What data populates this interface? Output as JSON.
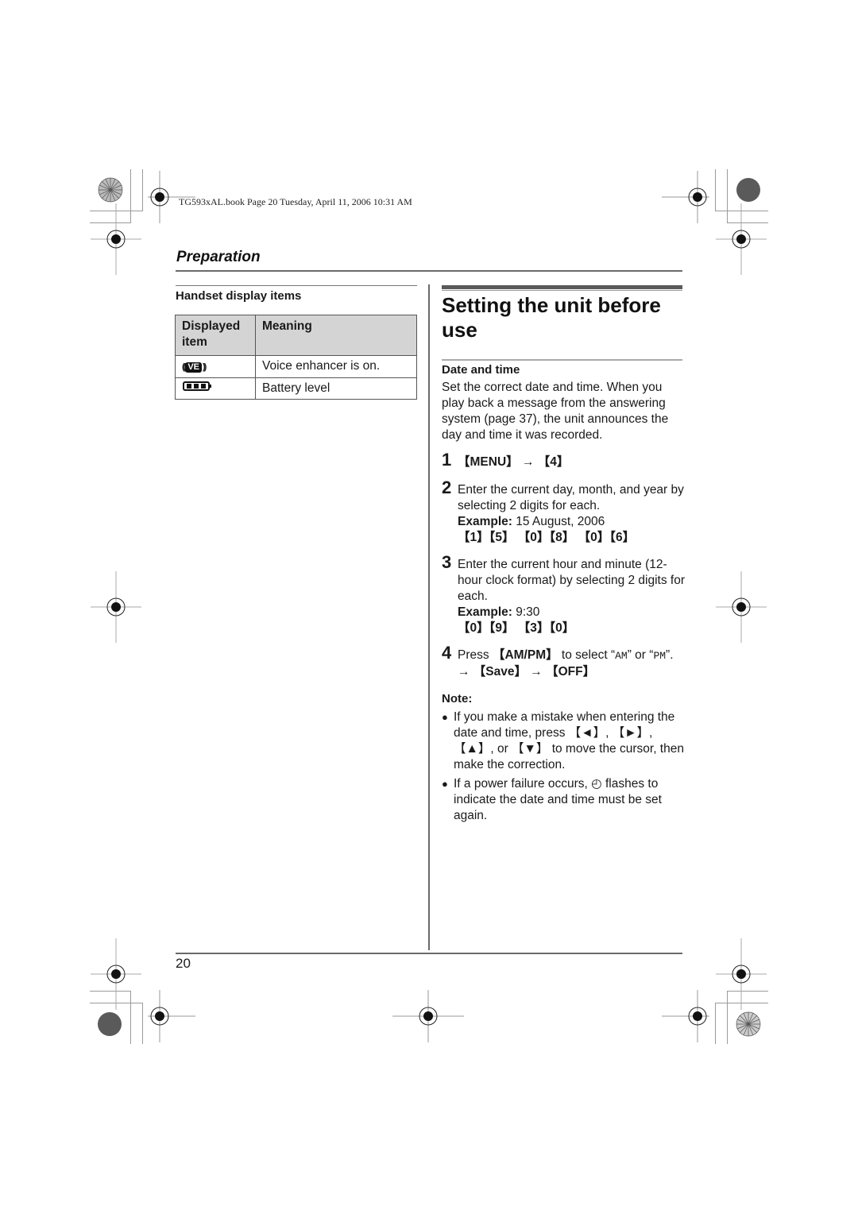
{
  "print_header": "TG593xAL.book  Page 20  Tuesday, April 11, 2006  10:31 AM",
  "section": {
    "title": "Preparation"
  },
  "left_column": {
    "heading": "Handset display items",
    "table": {
      "headers": [
        "Displayed item",
        "Meaning"
      ],
      "rows": [
        {
          "icon": "voice-enhancer-icon",
          "icon_text": "VE",
          "meaning": "Voice enhancer is on."
        },
        {
          "icon": "battery-icon",
          "icon_text": "",
          "meaning": "Battery level"
        }
      ]
    }
  },
  "right_column": {
    "title": "Setting the unit before use",
    "subheading": "Date and time",
    "intro": "Set the correct date and time. When you play back a message from the answering system (page 37), the unit announces the day and time it was recorded.",
    "steps": [
      {
        "num": "1",
        "keys": [
          "MENU",
          "4"
        ]
      },
      {
        "num": "2",
        "text": "Enter the current day, month, and year by selecting 2 digits for each.",
        "example_label": "Example:",
        "example_value": " 15 August, 2006",
        "key_sequence": "【1】【5】 【0】【8】 【0】【6】"
      },
      {
        "num": "3",
        "text": "Enter the current hour and minute (12-hour clock format) by selecting 2 digits for each.",
        "example_label": "Example:",
        "example_value": " 9:30",
        "key_sequence": "【0】【9】 【3】【0】"
      },
      {
        "num": "4",
        "text_before": "Press ",
        "key": "【AM/PM】",
        "text_mid": " to select “",
        "opt1": "AM",
        "text_or": "” or “",
        "opt2": "PM",
        "text_end": "”.",
        "sequence": "→ 【Save】 → 【OFF】"
      }
    ],
    "note": {
      "label": "Note:",
      "bullets": [
        "If you make a mistake when entering the date and time, press 【◄】, 【►】, 【▲】, or 【▼】 to move the cursor, then make the correction.",
        "If a power failure occurs, ◴ flashes to indicate the date and time must be set again."
      ]
    }
  },
  "footer": {
    "page_number": "20"
  },
  "step1_display": "【MENU】 → 【4】"
}
